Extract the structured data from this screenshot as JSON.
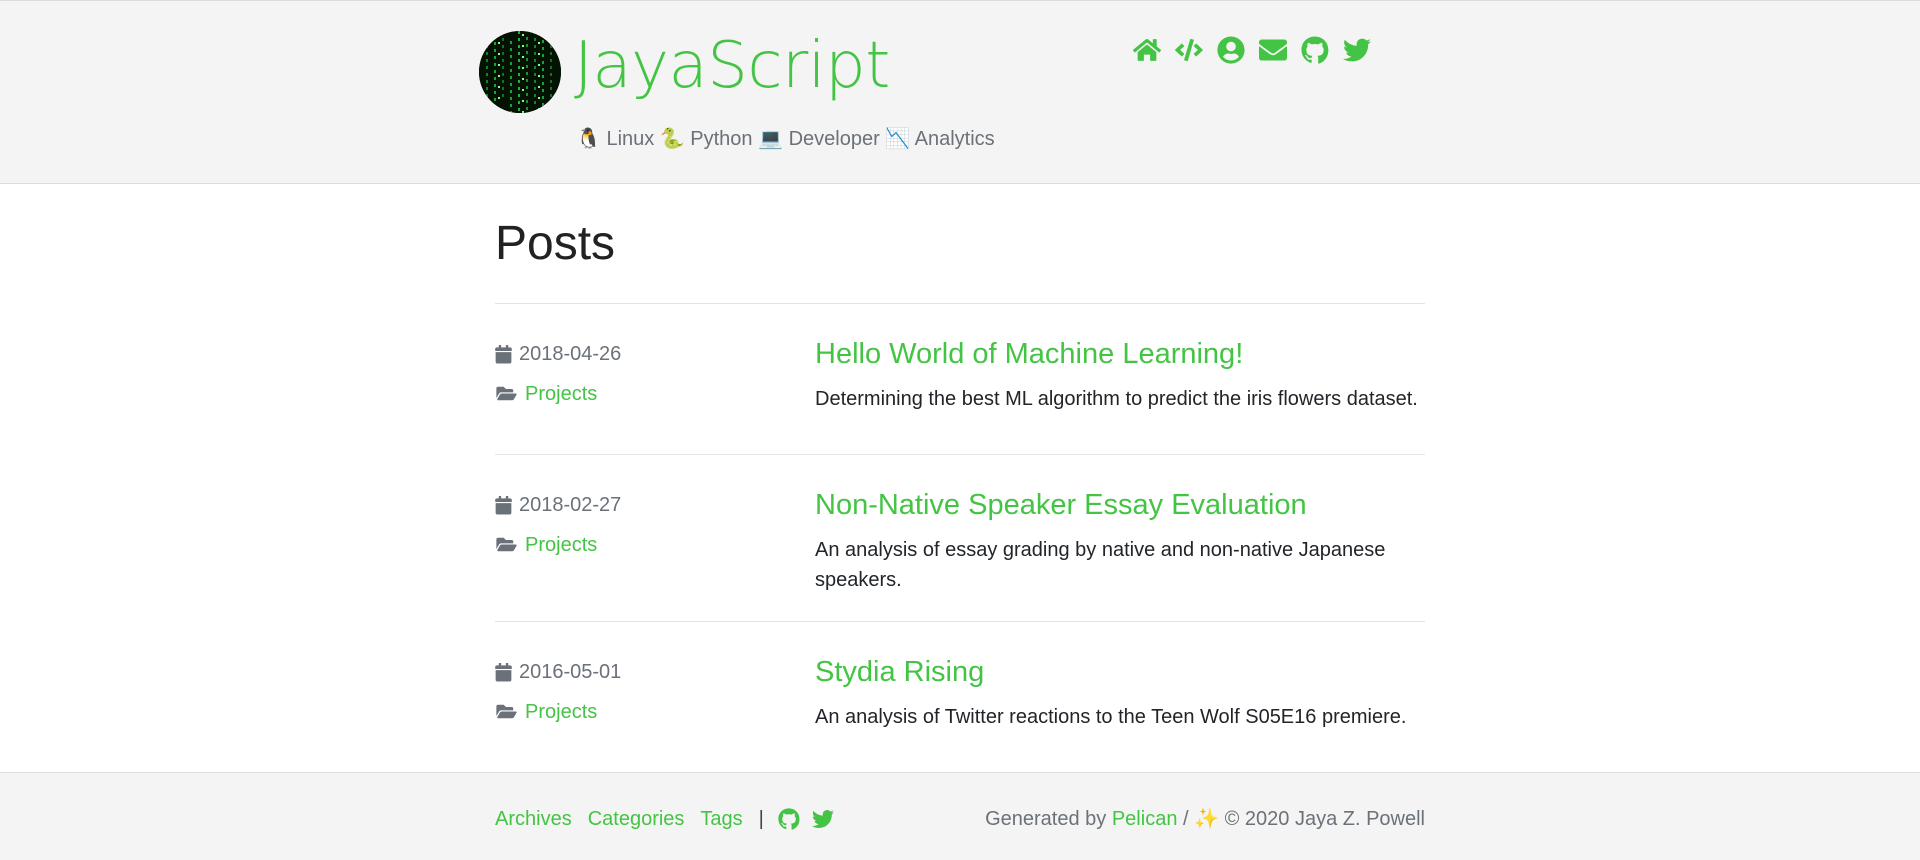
{
  "header": {
    "site_title": "JayaScript",
    "tagline": "🐧 Linux 🐍 Python 💻 Developer 📉 Analytics",
    "social_icons": [
      "home-icon",
      "code-icon",
      "user-circle-icon",
      "envelope-icon",
      "github-icon",
      "twitter-icon"
    ]
  },
  "main": {
    "page_title": "Posts",
    "posts": [
      {
        "date": "2018-04-26",
        "category": "Projects",
        "title": "Hello World of Machine Learning!",
        "summary": "Determining the best ML algorithm to predict the iris flowers dataset."
      },
      {
        "date": "2018-02-27",
        "category": "Projects",
        "title": "Non-Native Speaker Essay Evaluation",
        "summary": "An analysis of essay grading by native and non-native Japanese speakers."
      },
      {
        "date": "2016-05-01",
        "category": "Projects",
        "title": "Stydia Rising",
        "summary": "An analysis of Twitter reactions to the Teen Wolf S05E16 premiere."
      }
    ]
  },
  "footer": {
    "links": [
      "Archives",
      "Categories",
      "Tags"
    ],
    "separator": "|",
    "generated_prefix": "Generated by",
    "generator": "Pelican",
    "slash": "/",
    "sparkle": "✨",
    "copyright": "© 2020 Jaya Z. Powell"
  },
  "colors": {
    "accent": "#44c444",
    "muted": "#6b7178",
    "header_bg": "#f4f4f4"
  }
}
